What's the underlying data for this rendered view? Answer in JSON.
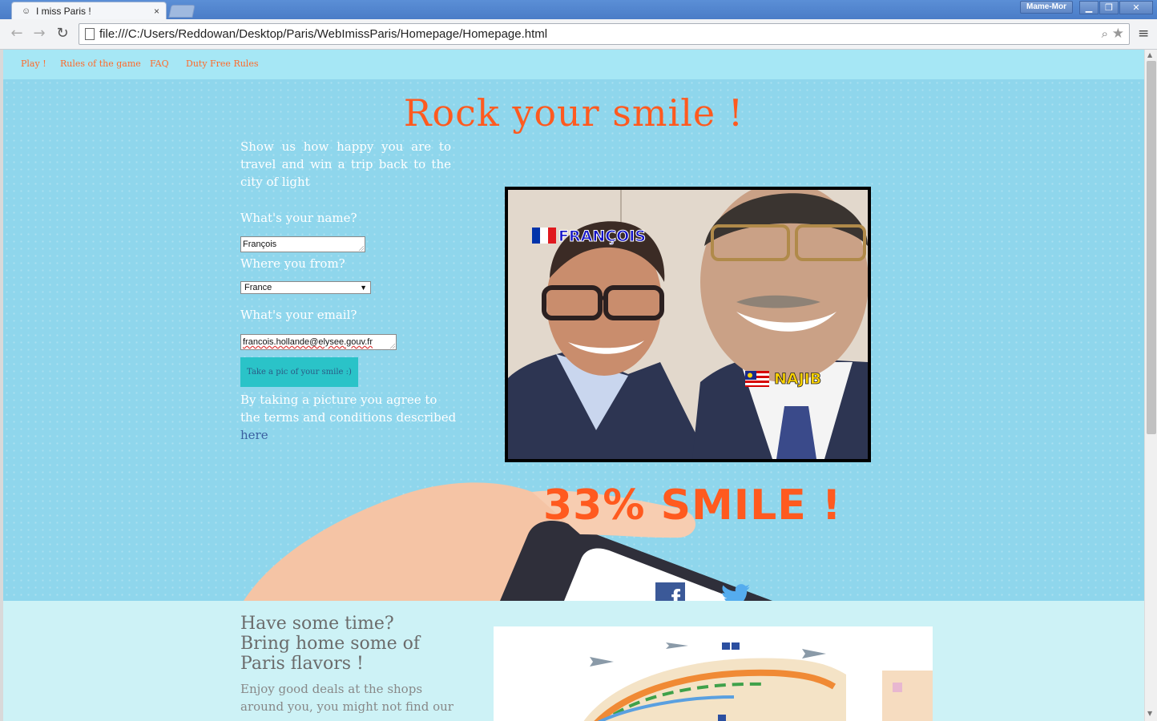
{
  "browser": {
    "tab_title": "I miss Paris !",
    "tab_close": "×",
    "user_name": "Mame-Mor",
    "url": "file:///C:/Users/Reddowan/Desktop/Paris/WebImissParis/Homepage/Homepage.html",
    "window_buttons": [
      "▁",
      "❐",
      "✕"
    ]
  },
  "nav": {
    "items": [
      "Play !",
      "Rules of the game",
      "FAQ",
      "Duty Free Rules"
    ]
  },
  "hero": {
    "title": "Rock your smile !",
    "intro": "Show us how happy you are to travel and win a trip back to the city of light",
    "name_label": "What's your name?",
    "name_value": "François",
    "from_label": "Where you from?",
    "from_value": "France",
    "email_label": "What's your email?",
    "email_value": "francois.hollande@elysee.gouv.fr",
    "button_label": "Take a pic of your smile :)",
    "terms_text": "By taking a picture you agree to the terms and conditions described ",
    "terms_link": "here",
    "photo_tag_left": "FRANÇOIS",
    "photo_tag_right": "NAJIB",
    "smile_score": "33% SMILE !"
  },
  "section2": {
    "title": "Have some time? Bring home some of Paris flavors !",
    "text": "Enjoy good deals at the shops around you, you might not find our"
  },
  "colors": {
    "accent": "#ff5a1f",
    "hero_bg": "#8fd6ec",
    "nav_bg": "#a6e7f5",
    "button_bg": "#2ac3c8",
    "facebook": "#3b5998",
    "twitter": "#55acee"
  },
  "icons": {
    "back": "arrow-left-icon",
    "forward": "arrow-right-icon",
    "reload": "reload-icon",
    "zoom": "magnifier-icon",
    "bookmark": "star-icon",
    "menu": "hamburger-icon",
    "facebook": "facebook-icon",
    "twitter": "twitter-icon"
  }
}
